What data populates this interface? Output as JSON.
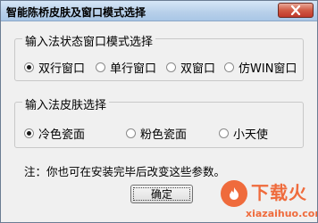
{
  "window": {
    "title": "智能陈桥皮肤及窗口模式选择"
  },
  "mode_group": {
    "legend": "输入法状态窗口模式选择",
    "options": [
      {
        "label": "双行窗口",
        "checked": true
      },
      {
        "label": "单行窗口",
        "checked": false
      },
      {
        "label": "双窗口",
        "checked": false
      },
      {
        "label": "仿WIN窗口",
        "checked": false
      }
    ]
  },
  "skin_group": {
    "legend": "输入法皮肤选择",
    "options": [
      {
        "label": "冷色瓷面",
        "checked": true
      },
      {
        "label": "粉色瓷面",
        "checked": false
      },
      {
        "label": "小天使",
        "checked": false
      }
    ]
  },
  "note": "注：你也可在安装完毕后改变这些参数。",
  "ok_button": "确定",
  "watermark": {
    "text": "下载火",
    "url": "xiazaihuo.com"
  },
  "colors": {
    "accent": "#ef6b3c",
    "title_bg": "#b9d1ea",
    "window_bg": "#f0f0f0"
  }
}
